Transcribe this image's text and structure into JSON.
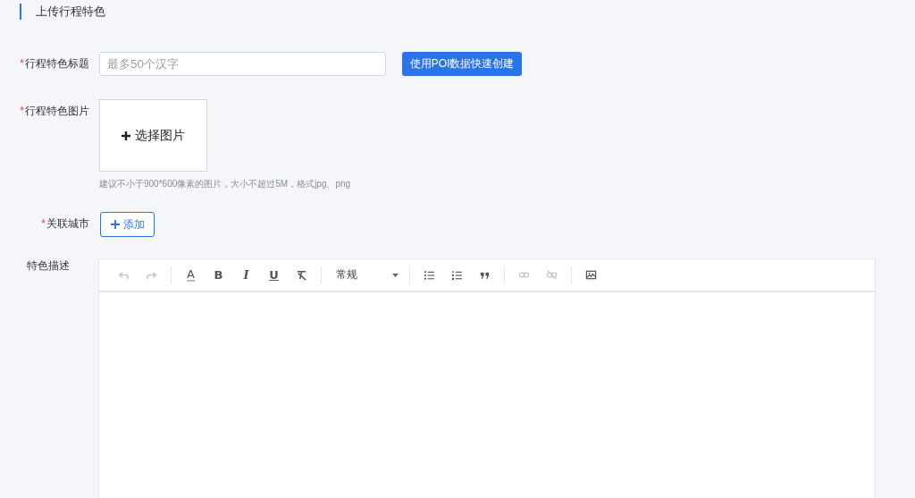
{
  "section_title": "上传行程特色",
  "required_mark": "*",
  "fields": [
    {
      "kind": "text",
      "label": "行程特色标题",
      "required": true,
      "placeholder": "最多50个汉字",
      "action": "使用POI数据快速创建"
    },
    {
      "kind": "image",
      "label": "行程特色图片",
      "required": true,
      "upload": "选择图片",
      "hint": "建议不小于900*600像素的图片，大小不超过5M，格式jpg、png"
    },
    {
      "kind": "add",
      "label": "关联城市",
      "required": true,
      "button": "添加"
    },
    {
      "kind": "editor",
      "label": "特色描述",
      "required": false
    }
  ],
  "toolbar": [
    [
      {
        "kind": "undo",
        "disabled": true
      },
      {
        "kind": "redo",
        "disabled": true
      }
    ],
    [
      {
        "kind": "color",
        "label": "A",
        "disabled": false
      },
      {
        "kind": "bold",
        "label": "B",
        "disabled": false
      },
      {
        "kind": "italic",
        "label": "I",
        "disabled": false
      },
      {
        "kind": "underline",
        "label": "U",
        "disabled": false
      },
      {
        "kind": "clear",
        "disabled": false
      }
    ],
    [
      {
        "kind": "select",
        "label": "常规"
      }
    ],
    [
      {
        "kind": "ul",
        "disabled": false
      },
      {
        "kind": "ol",
        "disabled": false
      },
      {
        "kind": "quote",
        "disabled": false
      }
    ],
    [
      {
        "kind": "link",
        "disabled": true
      },
      {
        "kind": "unlink",
        "disabled": true
      }
    ],
    [
      {
        "kind": "image",
        "disabled": false
      }
    ]
  ]
}
